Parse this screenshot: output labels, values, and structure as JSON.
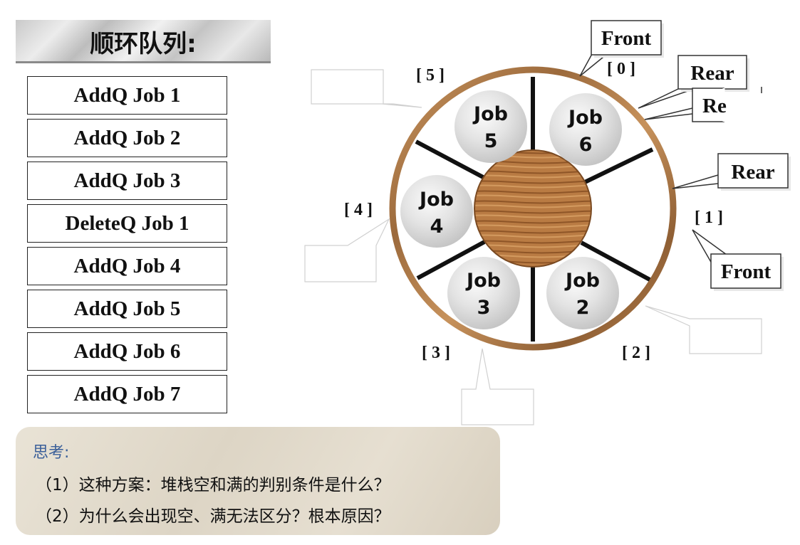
{
  "title": "顺环队列:",
  "operations": [
    "AddQ Job 1",
    "AddQ Job 2",
    "AddQ Job 3",
    "DeleteQ Job 1",
    "AddQ Job 4",
    "AddQ Job 5",
    "AddQ Job 6",
    "AddQ Job 7"
  ],
  "queue": {
    "indices": [
      "[ 0 ]",
      "[ 1 ]",
      "[ 2 ]",
      "[ 3 ]",
      "[ 4 ]",
      "[ 5 ]"
    ],
    "slots": [
      {
        "job": "Job",
        "num": "6"
      },
      {
        "job": "Job",
        "num": "2"
      },
      {
        "job": "Job",
        "num": "3"
      },
      {
        "job": "Job",
        "num": "4"
      },
      {
        "job": "Job",
        "num": "5"
      }
    ],
    "callouts": {
      "front_top": "Front",
      "rear_1": "Rear",
      "rear_2": "Re",
      "rear_3": "Rear",
      "front_right": "Front"
    }
  },
  "think": {
    "title": "思考:",
    "line1": "（1）这种方案：堆栈空和满的判别条件是什么？",
    "line2": "（2）为什么会出现空、满无法区分？根本原因？"
  }
}
